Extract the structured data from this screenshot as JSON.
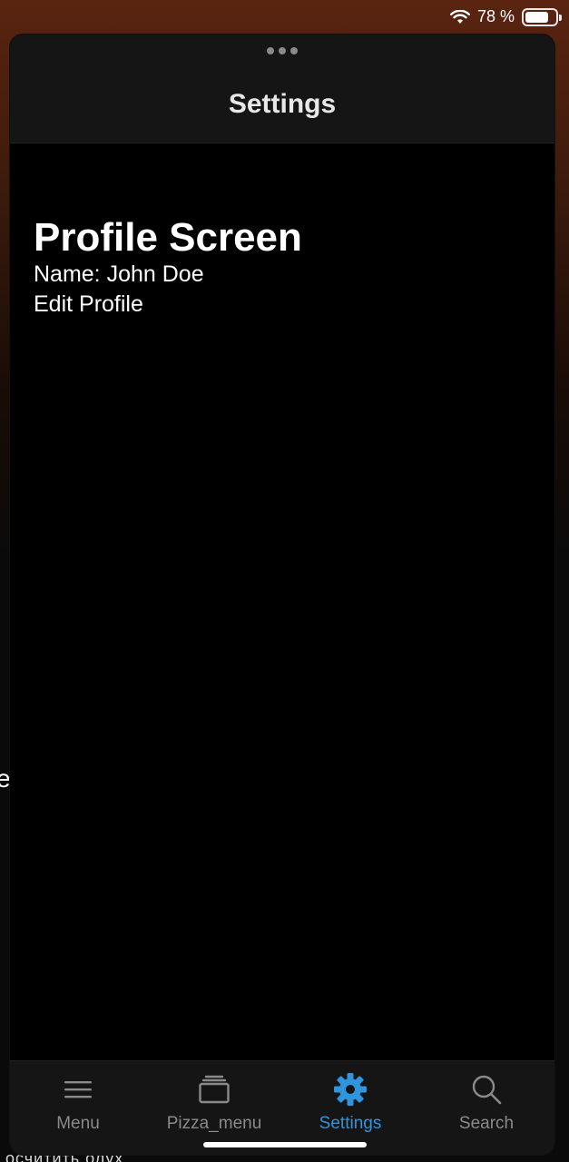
{
  "status_bar": {
    "battery_text": "78 %",
    "battery_level": 0.78,
    "icons": [
      "wifi-icon",
      "battery-icon"
    ]
  },
  "background": {
    "fragment_e": "e",
    "fragment_bottom": "осчитить олух"
  },
  "sheet": {
    "title": "Settings"
  },
  "content": {
    "heading": "Profile Screen",
    "name_line": "Name: John Doe",
    "edit_link": "Edit Profile"
  },
  "tabs": [
    {
      "label": "Menu",
      "icon": "hamburger-menu-icon",
      "active": false
    },
    {
      "label": "Pizza_menu",
      "icon": "stack-icon",
      "active": false
    },
    {
      "label": "Settings",
      "icon": "gear-icon",
      "active": true
    },
    {
      "label": "Search",
      "icon": "search-icon",
      "active": false
    }
  ],
  "colors": {
    "active_tab": "#2f95dc",
    "inactive_tab": "#8a8a8a",
    "header_bg": "#151515"
  }
}
